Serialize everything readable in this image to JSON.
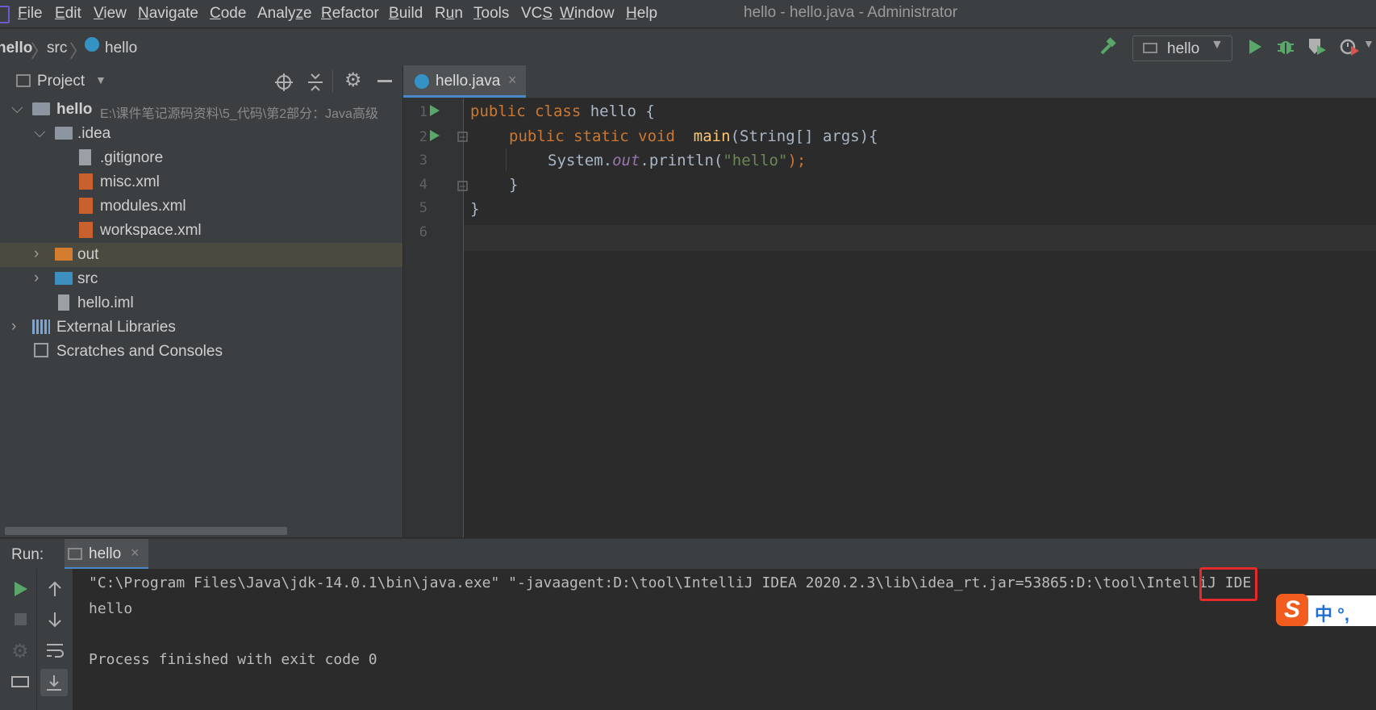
{
  "menubar": {
    "items": [
      "File",
      "Edit",
      "View",
      "Navigate",
      "Code",
      "Analyze",
      "Refactor",
      "Build",
      "Run",
      "Tools",
      "VCS",
      "Window",
      "Help"
    ],
    "mnemonics": [
      "F",
      "E",
      "V",
      "N",
      "C",
      "z",
      "R",
      "B",
      "u",
      "T",
      "S",
      "W",
      "H"
    ],
    "title": "hello - hello.java - Administrator"
  },
  "navbar": {
    "crumbs": [
      "hello",
      "src",
      "hello"
    ],
    "run_config": "hello"
  },
  "project": {
    "title": "Project",
    "tree": [
      {
        "label": "hello",
        "path": "E:\\课件笔记源码资料\\5_代码\\第2部分：Java高级"
      },
      {
        "label": ".idea"
      },
      {
        "label": ".gitignore"
      },
      {
        "label": "misc.xml"
      },
      {
        "label": "modules.xml"
      },
      {
        "label": "workspace.xml"
      },
      {
        "label": "out"
      },
      {
        "label": "src"
      },
      {
        "label": "hello.iml"
      },
      {
        "label": "External Libraries"
      },
      {
        "label": "Scratches and Consoles"
      }
    ]
  },
  "editor": {
    "tab_label": "hello.java",
    "line_numbers": [
      "1",
      "2",
      "3",
      "4",
      "5",
      "6"
    ],
    "code": {
      "l1_kw": "public class ",
      "l1_rest": "hello {",
      "l2_kw": "public static void ",
      "l2_fn": "main",
      "l2_rest": "(String[] args){",
      "l3_a": "System.",
      "l3_b": "out",
      "l3_c": ".println(",
      "l3_str": "\"hello\"",
      "l3_d": ");",
      "l4": "}",
      "l5": "}"
    }
  },
  "run": {
    "label": "Run:",
    "tab_label": "hello",
    "console_lines": [
      "\"C:\\Program Files\\Java\\jdk-14.0.1\\bin\\java.exe\" \"-javaagent:D:\\tool\\IntelliJ IDEA 2020.2.3\\lib\\idea_rt.jar=53865:D:\\tool\\IntelliJ IDE",
      "hello",
      "",
      "Process finished with exit code 0"
    ],
    "highlight_color": "#e52a2a"
  },
  "ime": {
    "logo": "S",
    "text": "中 °,"
  },
  "colors": {
    "accent": "#4a88c7",
    "run_green": "#59a869",
    "keyword": "#cc7832",
    "string": "#6a8759"
  }
}
